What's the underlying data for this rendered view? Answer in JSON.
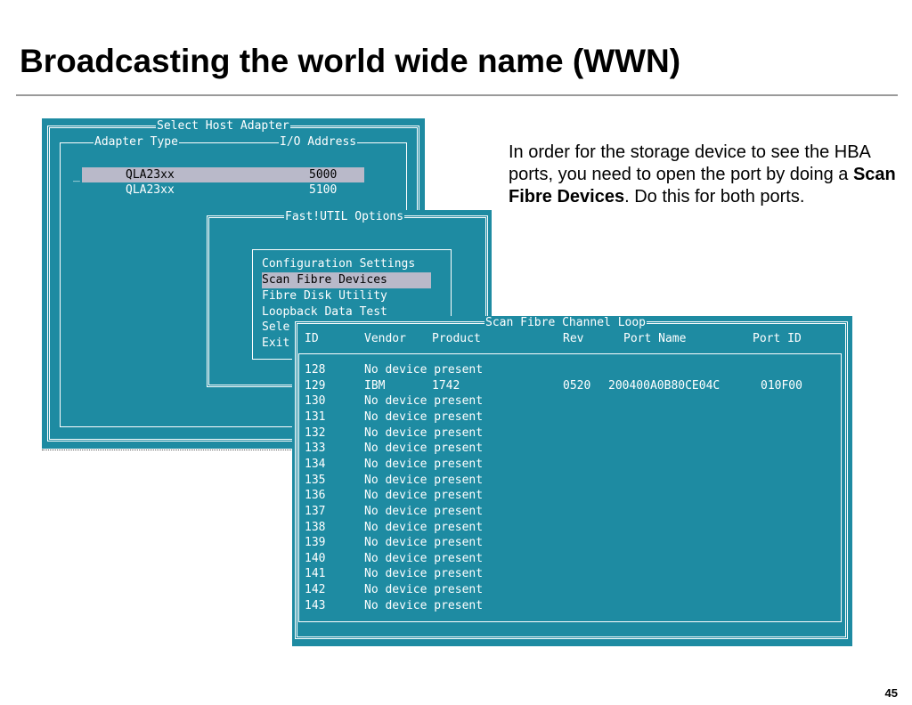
{
  "slide": {
    "title": "Broadcasting the world wide name (WWN)",
    "desc_part1": "In order for the storage device to see the HBA ports, you need to open the port by doing a ",
    "desc_bold": "Scan Fibre Devices",
    "desc_part2": ". Do this for both ports.",
    "page_number": "45"
  },
  "select_host_adapter": {
    "title": "Select Host Adapter",
    "col_type": "Adapter Type",
    "col_io": "I/O Address",
    "cursor": "_",
    "rows": [
      {
        "type": "QLA23xx",
        "io": "5000",
        "selected": true
      },
      {
        "type": "QLA23xx",
        "io": "5100",
        "selected": false
      }
    ]
  },
  "fastutil_options": {
    "title": "Fast!UTIL Options",
    "items": [
      {
        "label": "Configuration Settings",
        "selected": false
      },
      {
        "label": "Scan Fibre Devices",
        "selected": true
      },
      {
        "label": "Fibre Disk Utility",
        "selected": false
      },
      {
        "label": "Loopback Data Test",
        "selected": false
      },
      {
        "label": "Sele",
        "selected": false
      },
      {
        "label": "Exit",
        "selected": false
      }
    ]
  },
  "scan_loop": {
    "title": "Scan Fibre Channel Loop",
    "headers": {
      "id": "ID",
      "vendor": "Vendor",
      "product": "Product",
      "rev": "Rev",
      "port_name": "Port Name",
      "port_id": "Port ID"
    },
    "rows": [
      {
        "id": "128",
        "vendor": "No device present",
        "product": "",
        "rev": "",
        "port_name": "",
        "port_id": ""
      },
      {
        "id": "129",
        "vendor": "IBM",
        "product": "1742",
        "rev": "0520",
        "port_name": "200400A0B80CE04C",
        "port_id": "010F00"
      },
      {
        "id": "130",
        "vendor": "No device present",
        "product": "",
        "rev": "",
        "port_name": "",
        "port_id": ""
      },
      {
        "id": "131",
        "vendor": "No device present",
        "product": "",
        "rev": "",
        "port_name": "",
        "port_id": ""
      },
      {
        "id": "132",
        "vendor": "No device present",
        "product": "",
        "rev": "",
        "port_name": "",
        "port_id": ""
      },
      {
        "id": "133",
        "vendor": "No device present",
        "product": "",
        "rev": "",
        "port_name": "",
        "port_id": ""
      },
      {
        "id": "134",
        "vendor": "No device present",
        "product": "",
        "rev": "",
        "port_name": "",
        "port_id": ""
      },
      {
        "id": "135",
        "vendor": "No device present",
        "product": "",
        "rev": "",
        "port_name": "",
        "port_id": ""
      },
      {
        "id": "136",
        "vendor": "No device present",
        "product": "",
        "rev": "",
        "port_name": "",
        "port_id": ""
      },
      {
        "id": "137",
        "vendor": "No device present",
        "product": "",
        "rev": "",
        "port_name": "",
        "port_id": ""
      },
      {
        "id": "138",
        "vendor": "No device present",
        "product": "",
        "rev": "",
        "port_name": "",
        "port_id": ""
      },
      {
        "id": "139",
        "vendor": "No device present",
        "product": "",
        "rev": "",
        "port_name": "",
        "port_id": ""
      },
      {
        "id": "140",
        "vendor": "No device present",
        "product": "",
        "rev": "",
        "port_name": "",
        "port_id": ""
      },
      {
        "id": "141",
        "vendor": "No device present",
        "product": "",
        "rev": "",
        "port_name": "",
        "port_id": ""
      },
      {
        "id": "142",
        "vendor": "No device present",
        "product": "",
        "rev": "",
        "port_name": "",
        "port_id": ""
      },
      {
        "id": "143",
        "vendor": "No device present",
        "product": "",
        "rev": "",
        "port_name": "",
        "port_id": ""
      }
    ]
  }
}
